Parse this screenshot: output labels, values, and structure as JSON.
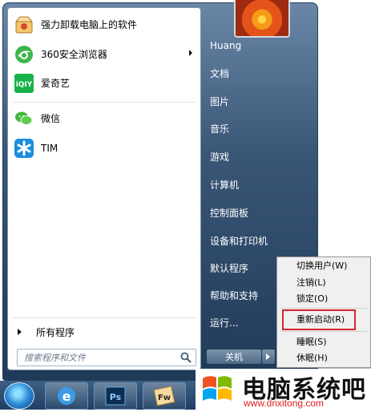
{
  "start_menu": {
    "pinned": [
      {
        "label": "强力卸载电脑上的软件",
        "icon": "uninstall-box-icon",
        "has_submenu": false
      },
      {
        "label": "360安全浏览器",
        "icon": "360-browser-icon",
        "has_submenu": true
      },
      {
        "label": "爱奇艺",
        "icon": "iqiyi-icon",
        "has_submenu": false
      }
    ],
    "recent": [
      {
        "label": "微信",
        "icon": "wechat-icon"
      },
      {
        "label": "TIM",
        "icon": "tim-icon"
      }
    ],
    "all_programs": "所有程序",
    "search_placeholder": "搜索程序和文件"
  },
  "right_panel": {
    "items": [
      "Huang",
      "文档",
      "图片",
      "音乐",
      "游戏",
      "计算机",
      "控制面板",
      "设备和打印机",
      "默认程序",
      "帮助和支持",
      "运行..."
    ],
    "shutdown_label": "关机"
  },
  "shutdown_menu": {
    "items": [
      "切换用户(W)",
      "注销(L)",
      "锁定(O)",
      "重新启动(R)",
      "睡眠(S)",
      "休眠(H)"
    ],
    "highlighted": "重新启动(R)",
    "highlight_color": "#d3262b"
  },
  "taskbar": {
    "buttons": [
      "start-orb-icon",
      "ie-icon",
      "photoshop-icon",
      "fireworks-icon"
    ],
    "ps_label": "Ps",
    "fw_label": "Fw"
  },
  "watermark": {
    "title": "电脑系统吧",
    "url": "www.dnxitong.com"
  }
}
